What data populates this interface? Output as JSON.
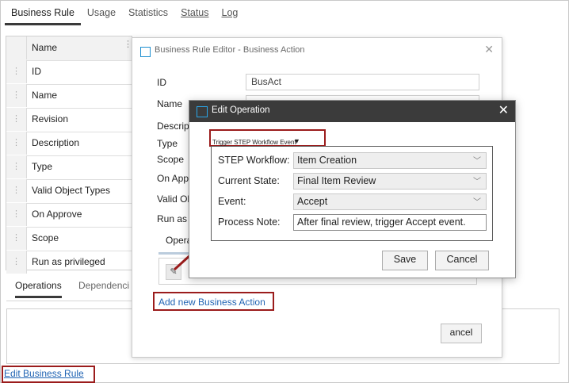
{
  "tabs": [
    "Business Rule",
    "Usage",
    "Statistics",
    "Status",
    "Log"
  ],
  "grid": {
    "header": "Name",
    "rows": [
      "ID",
      "Name",
      "Revision",
      "Description",
      "Type",
      "Valid Object Types",
      "On Approve",
      "Scope",
      "Run as privileged"
    ]
  },
  "subtabs": [
    "Operations",
    "Dependenci"
  ],
  "edit_link": "Edit Business Rule",
  "bre": {
    "title": "Business Rule Editor - Business Action",
    "fields": [
      {
        "label": "ID",
        "value": "BusAct"
      },
      {
        "label": "Name",
        "value": ""
      },
      {
        "label": "Descrip",
        "value": ""
      },
      {
        "label": "Type",
        "value": ""
      },
      {
        "label": "Scope",
        "value": ""
      },
      {
        "label": "On App",
        "value": ""
      },
      {
        "label": "Valid Ob",
        "value": ""
      },
      {
        "label": "Run as",
        "value": ""
      }
    ],
    "subtab": "Opera",
    "add_link": "Add new Business Action",
    "cancel_partial": "ancel"
  },
  "eo": {
    "title": "Edit Operation",
    "operation_type": "Trigger STEP Workflow Event",
    "fields": [
      {
        "label": "STEP Workflow:",
        "value": "Item Creation"
      },
      {
        "label": "Current State:",
        "value": "Final Item Review"
      },
      {
        "label": "Event:",
        "value": "Accept"
      },
      {
        "label": "Process Note:",
        "value": "After final review, trigger Accept event."
      }
    ],
    "save": "Save",
    "cancel": "Cancel"
  },
  "colors": {
    "accent_link": "#1f63b3",
    "highlight": "#9b1c1c",
    "dialog_title_bar": "#3b3b3b"
  }
}
